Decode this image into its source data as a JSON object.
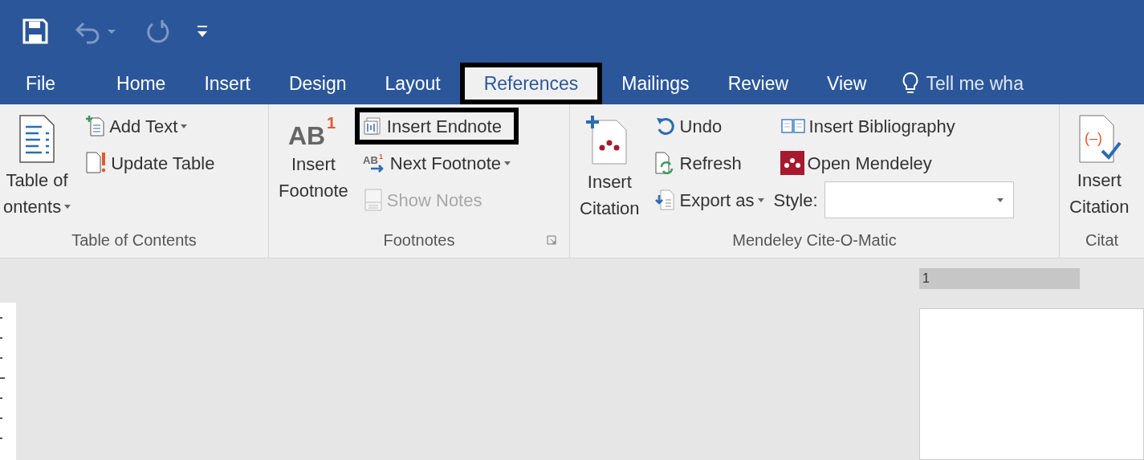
{
  "quick_access": [
    {
      "kind": "save",
      "disabled": false
    },
    {
      "kind": "undo",
      "disabled": true
    },
    {
      "kind": "redo",
      "disabled": true
    },
    {
      "kind": "customize",
      "disabled": false
    }
  ],
  "tabs": [
    {
      "label": "File",
      "selected": false,
      "outlined": false
    },
    {
      "label": "Home",
      "selected": false,
      "outlined": false
    },
    {
      "label": "Insert",
      "selected": false,
      "outlined": false
    },
    {
      "label": "Design",
      "selected": false,
      "outlined": false
    },
    {
      "label": "Layout",
      "selected": false,
      "outlined": false
    },
    {
      "label": "References",
      "selected": true,
      "outlined": true
    },
    {
      "label": "Mailings",
      "selected": false,
      "outlined": false
    },
    {
      "label": "Review",
      "selected": false,
      "outlined": false
    },
    {
      "label": "View",
      "selected": false,
      "outlined": false
    }
  ],
  "tell_me": "Tell me wha",
  "groups": [
    {
      "label": "Table of Contents",
      "large": {
        "lines": [
          "Table of",
          "ontents"
        ],
        "kind": "toc"
      },
      "small": [
        {
          "label": "Add Text",
          "kind": "addtext",
          "dropdown": true,
          "disabled": false,
          "outlined": false
        },
        {
          "label": "Update Table",
          "kind": "update",
          "dropdown": false,
          "disabled": false,
          "outlined": false
        }
      ]
    },
    {
      "label": "Footnotes",
      "launcher": true,
      "large": {
        "lines": [
          "Insert",
          "Footnote"
        ],
        "kind": "footnote",
        "icon_text": [
          "AB",
          "1"
        ]
      },
      "small": [
        {
          "label": "Insert Endnote",
          "kind": "endnote",
          "dropdown": false,
          "disabled": false,
          "outlined": true
        },
        {
          "label": "Next Footnote",
          "kind": "next",
          "icon_text": [
            "AB",
            "1"
          ],
          "dropdown": true,
          "disabled": false,
          "outlined": false
        },
        {
          "label": "Show Notes",
          "kind": "shownotes",
          "dropdown": false,
          "disabled": true,
          "outlined": false
        }
      ]
    },
    {
      "label": "Mendeley Cite-O-Matic",
      "large": {
        "lines": [
          "Insert",
          "Citation"
        ],
        "kind": "mendeley"
      },
      "small": [
        {
          "label": "Undo",
          "kind": "undo",
          "dropdown": false,
          "disabled": false,
          "outlined": false
        },
        {
          "label": "Refresh",
          "kind": "refresh",
          "dropdown": false,
          "disabled": false,
          "outlined": false
        },
        {
          "label": "Export as",
          "kind": "export",
          "dropdown": true,
          "disabled": false,
          "outlined": false
        }
      ],
      "small2": [
        {
          "label": "Insert Bibliography",
          "kind": "bib",
          "dropdown": false,
          "disabled": false,
          "outlined": false
        },
        {
          "label": "Open Mendeley",
          "kind": "open",
          "dropdown": false,
          "disabled": false,
          "outlined": false
        }
      ],
      "style_label": "Style:"
    },
    {
      "label": "Citat",
      "large": {
        "lines": [
          "Insert",
          "Citation"
        ],
        "kind": "citation",
        "icon_text": [
          "(–)"
        ]
      }
    }
  ],
  "ruler": {
    "number": "1"
  }
}
